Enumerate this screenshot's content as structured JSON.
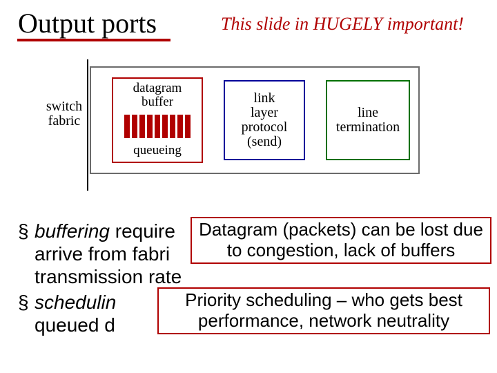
{
  "title": "Output ports",
  "subtitle": "This slide in HUGELY important!",
  "diagram": {
    "switch_label": "switch\nfabric",
    "buffer_top": "datagram\nbuffer",
    "buffer_bottom": "queueing",
    "mid_box": "link\nlayer\nprotocol\n(send)",
    "right_box": "line\ntermination"
  },
  "bullets": {
    "b1_emph": "buffering",
    "b1_rest_line1": " require",
    "b1_rest_line2": "arrive from fabri",
    "b1_rest_line3": "transmission rate",
    "b2_emph": "schedulin",
    "b2_rest": "queued d"
  },
  "overlays": {
    "o1": "Datagram (packets) can be lost due to congestion, lack of buffers",
    "o2": "Priority scheduling – who gets best performance, network neutrality"
  }
}
